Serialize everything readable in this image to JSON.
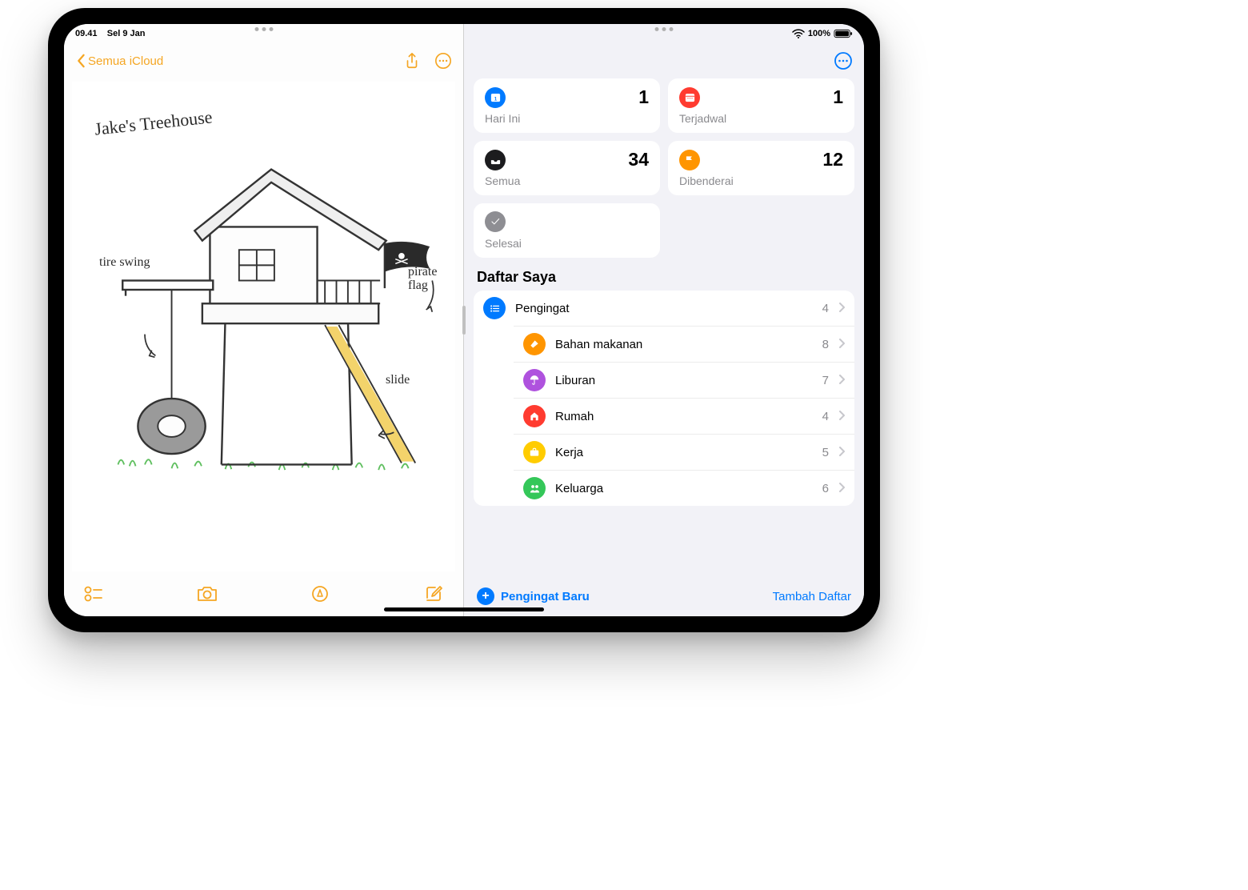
{
  "status": {
    "time": "09.41",
    "date": "Sel 9 Jan",
    "battery": "100%"
  },
  "notes": {
    "back_label": "Semua iCloud",
    "meta_line1": "",
    "meta_line2": "",
    "sketch": {
      "title": "Jake's Treehouse",
      "labels": {
        "tire_swing": "tire swing",
        "pirate_flag": "pirate flag",
        "slide": "slide"
      }
    }
  },
  "reminders": {
    "smart": [
      {
        "id": "today",
        "label": "Hari Ini",
        "count": 1,
        "color": "bg-blue",
        "glyph": "calendar-day"
      },
      {
        "id": "scheduled",
        "label": "Terjadwal",
        "count": 1,
        "color": "bg-red",
        "glyph": "calendar"
      },
      {
        "id": "all",
        "label": "Semua",
        "count": 34,
        "color": "bg-black",
        "glyph": "tray"
      },
      {
        "id": "flagged",
        "label": "Dibenderai",
        "count": 12,
        "color": "bg-orange",
        "glyph": "flag"
      },
      {
        "id": "done",
        "label": "Selesai",
        "count": "",
        "color": "bg-grey",
        "glyph": "check"
      }
    ],
    "my_lists_header": "Daftar Saya",
    "lists": [
      {
        "name": "Pengingat",
        "count": 4,
        "color": "bg-blue",
        "glyph": "list"
      },
      {
        "name": "Bahan makanan",
        "count": 8,
        "color": "bg-orange",
        "glyph": "carrot"
      },
      {
        "name": "Liburan",
        "count": 7,
        "color": "bg-purple",
        "glyph": "umbrella"
      },
      {
        "name": "Rumah",
        "count": 4,
        "color": "bg-red",
        "glyph": "house"
      },
      {
        "name": "Kerja",
        "count": 5,
        "color": "bg-yellow",
        "glyph": "briefcase"
      },
      {
        "name": "Keluarga",
        "count": 6,
        "color": "bg-green",
        "glyph": "family"
      }
    ],
    "new_reminder_label": "Pengingat Baru",
    "add_list_label": "Tambah Daftar"
  }
}
